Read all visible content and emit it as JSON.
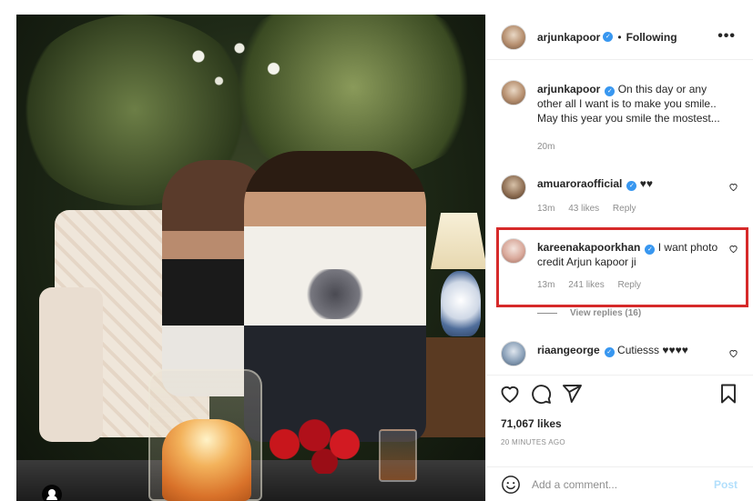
{
  "post": {
    "author": "arjunkapoor",
    "follow_status": "Following",
    "more_label": "•••",
    "caption_lines": [
      "On this day or any other all I want is to make you smile..",
      "May this year you smile the mostest..."
    ],
    "caption_time": "20m"
  },
  "comments": [
    {
      "user": "amuaroraofficial",
      "text": "♥♥",
      "time": "13m",
      "likes": "43 likes",
      "reply": "Reply"
    },
    {
      "user": "kareenakapoorkhan",
      "text": "I want photo credit Arjun kapoor ji",
      "time": "13m",
      "likes": "241 likes",
      "reply": "Reply",
      "view_replies": "View replies (16)"
    },
    {
      "user": "riaangeorge",
      "text": "Cutiesss ♥♥♥♥"
    }
  ],
  "stats": {
    "likes": "71,067 likes",
    "time_ago": "20 MINUTES AGO"
  },
  "composer": {
    "placeholder": "Add a comment...",
    "post_label": "Post"
  },
  "colors": {
    "highlight_border": "#d62a2a",
    "verified_badge": "#3897f0",
    "post_button": "#b2dffc"
  }
}
